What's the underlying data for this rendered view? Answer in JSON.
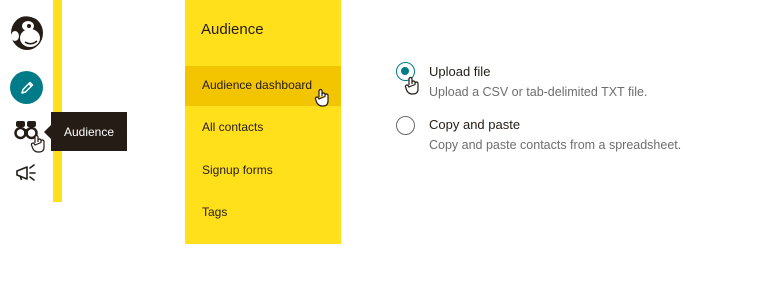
{
  "rail": {
    "tooltip": "Audience"
  },
  "panel": {
    "title": "Audience",
    "items": [
      {
        "label": "Audience dashboard"
      },
      {
        "label": "All contacts"
      },
      {
        "label": "Signup forms"
      },
      {
        "label": "Tags"
      }
    ]
  },
  "import_options": [
    {
      "title": "Upload file",
      "description": "Upload a CSV or tab-delimited TXT file.",
      "selected": true
    },
    {
      "title": "Copy and paste",
      "description": "Copy and paste contacts from a spreadsheet.",
      "selected": false
    }
  ],
  "colors": {
    "brand_yellow": "#ffe01b",
    "active_yellow": "#f2c500",
    "teal": "#007c89",
    "dark": "#241c15"
  },
  "icons": [
    "mailchimp-logo-icon",
    "pencil-icon",
    "binoculars-icon",
    "megaphone-icon",
    "hand-cursor-icon"
  ]
}
